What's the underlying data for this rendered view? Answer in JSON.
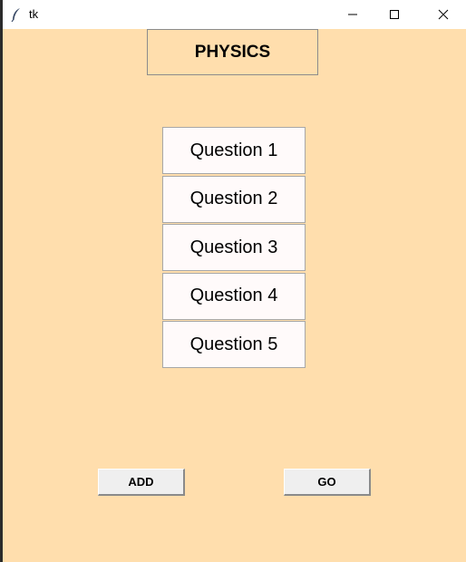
{
  "window": {
    "title": "tk"
  },
  "header": {
    "subject": "PHYSICS"
  },
  "questions": [
    {
      "label": "Question 1"
    },
    {
      "label": "Question 2"
    },
    {
      "label": "Question 3"
    },
    {
      "label": "Question 4"
    },
    {
      "label": "Question 5"
    }
  ],
  "actions": {
    "add_label": "ADD",
    "go_label": "GO"
  },
  "colors": {
    "background": "#ffdead",
    "question_button_bg": "#fffafa",
    "action_button_bg": "#efefef"
  },
  "icons": {
    "app": "tk-feather-icon",
    "minimize": "minimize-icon",
    "maximize": "maximize-icon",
    "close": "close-icon"
  }
}
